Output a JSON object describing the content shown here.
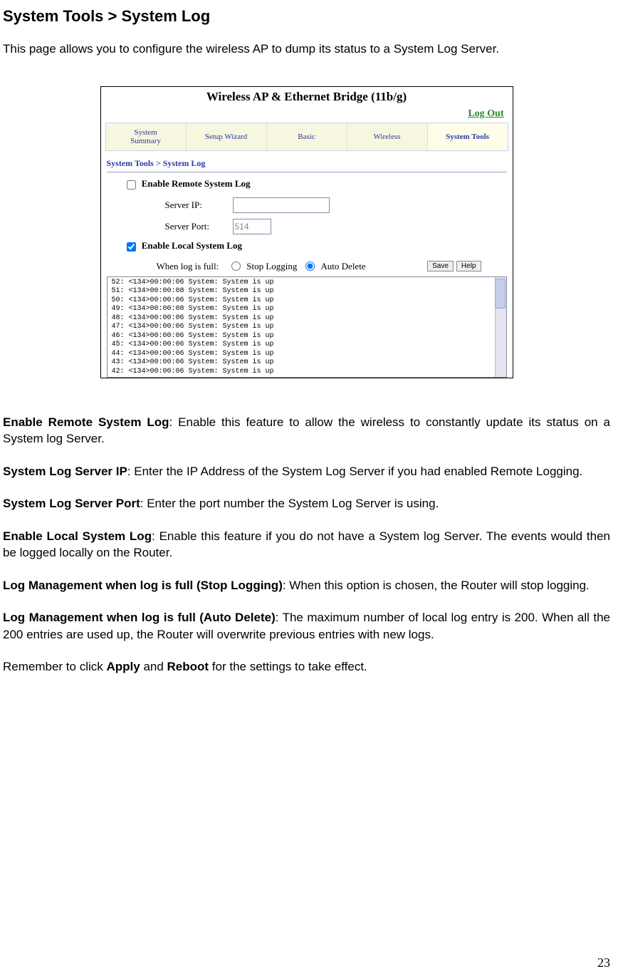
{
  "title": "System Tools > System Log",
  "intro": "This page allows you to configure the wireless AP to dump its status to a System Log Server.",
  "page_number": "23",
  "screenshot": {
    "header": "Wireless AP & Ethernet Bridge (11b/g)",
    "logout": "Log Out",
    "nav": {
      "summary": "System\nSummary",
      "setup": "Setup Wizard",
      "basic": "Basic",
      "wireless": "Wireless",
      "tools": "System Tools"
    },
    "breadcrumb": "System Tools > System Log",
    "remote_chk": "Enable Remote System Log",
    "server_ip_lbl": "Server IP:",
    "server_port_lbl": "Server Port:",
    "server_port_val": "514",
    "local_chk": "Enable Local System Log",
    "full_lbl": "When log is full:",
    "radio_stop": "Stop Logging",
    "radio_auto": "Auto Delete",
    "save_btn": "Save",
    "help_btn": "Help",
    "log_lines": "52: <134>00:00:06 System: System is up\n51: <134>00:00:08 System: System is up\n50: <134>00:00:06 System: System is up\n49: <134>00:00:08 System: System is up\n48: <134>00:00:06 System: System is up\n47: <134>00:00:06 System: System is up\n46: <134>00:00:06 System: System is up\n45: <134>00:00:06 System: System is up\n44: <134>00:00:06 System: System is up\n43: <134>00:00:06 System: System is up\n42: <134>00:00:06 System: System is up"
  },
  "body": {
    "p1_b": "Enable Remote System Log",
    "p1_t": ": Enable this feature to allow the wireless to constantly update its status on a System log Server.",
    "p2_b": "System Log Server IP",
    "p2_t": ": Enter the IP Address of the System Log Server if you had enabled Remote Logging.",
    "p3_b": "System Log Server Port",
    "p3_t": ": Enter the port number the System Log Server is using.",
    "p4_b": "Enable Local System Log",
    "p4_t": ": Enable this feature if you do not have a System log Server. The events would then be logged locally on the Router.",
    "p5_b": "Log Management when log is full (Stop Logging)",
    "p5_t": ": When this option is chosen, the Router will stop logging.",
    "p6_b": "Log Management when log is full (Auto Delete)",
    "p6_t": ": The maximum number of local log entry is 200. When all the 200 entries are used up, the Router will overwrite previous entries with new logs.",
    "p7_a": "Remember to click ",
    "p7_b1": "Apply",
    "p7_m": " and ",
    "p7_b2": "Reboot",
    "p7_c": " for the settings to take effect."
  }
}
